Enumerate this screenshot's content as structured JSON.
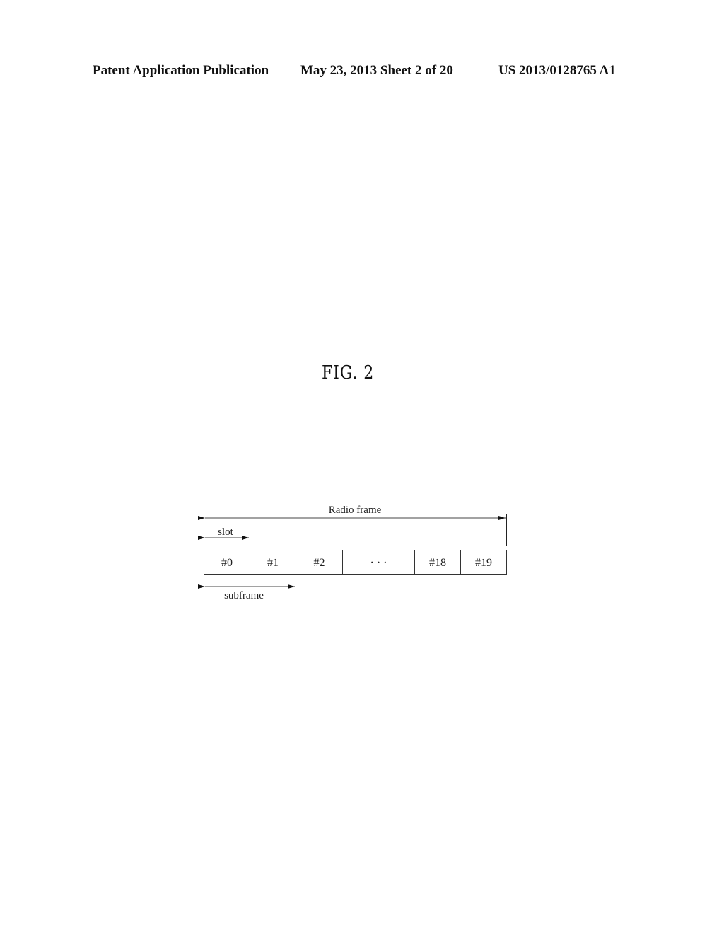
{
  "header": {
    "left": "Patent Application Publication",
    "middle": "May 23, 2013   Sheet 2 of 20",
    "right": "US 2013/0128765 A1"
  },
  "figure": {
    "title": "FIG. 2",
    "labels": {
      "radio_frame": "Radio frame",
      "slot": "slot",
      "subframe": "subframe"
    },
    "slots": [
      "#0",
      "#1",
      "#2",
      "· · ·",
      "#18",
      "#19"
    ]
  }
}
